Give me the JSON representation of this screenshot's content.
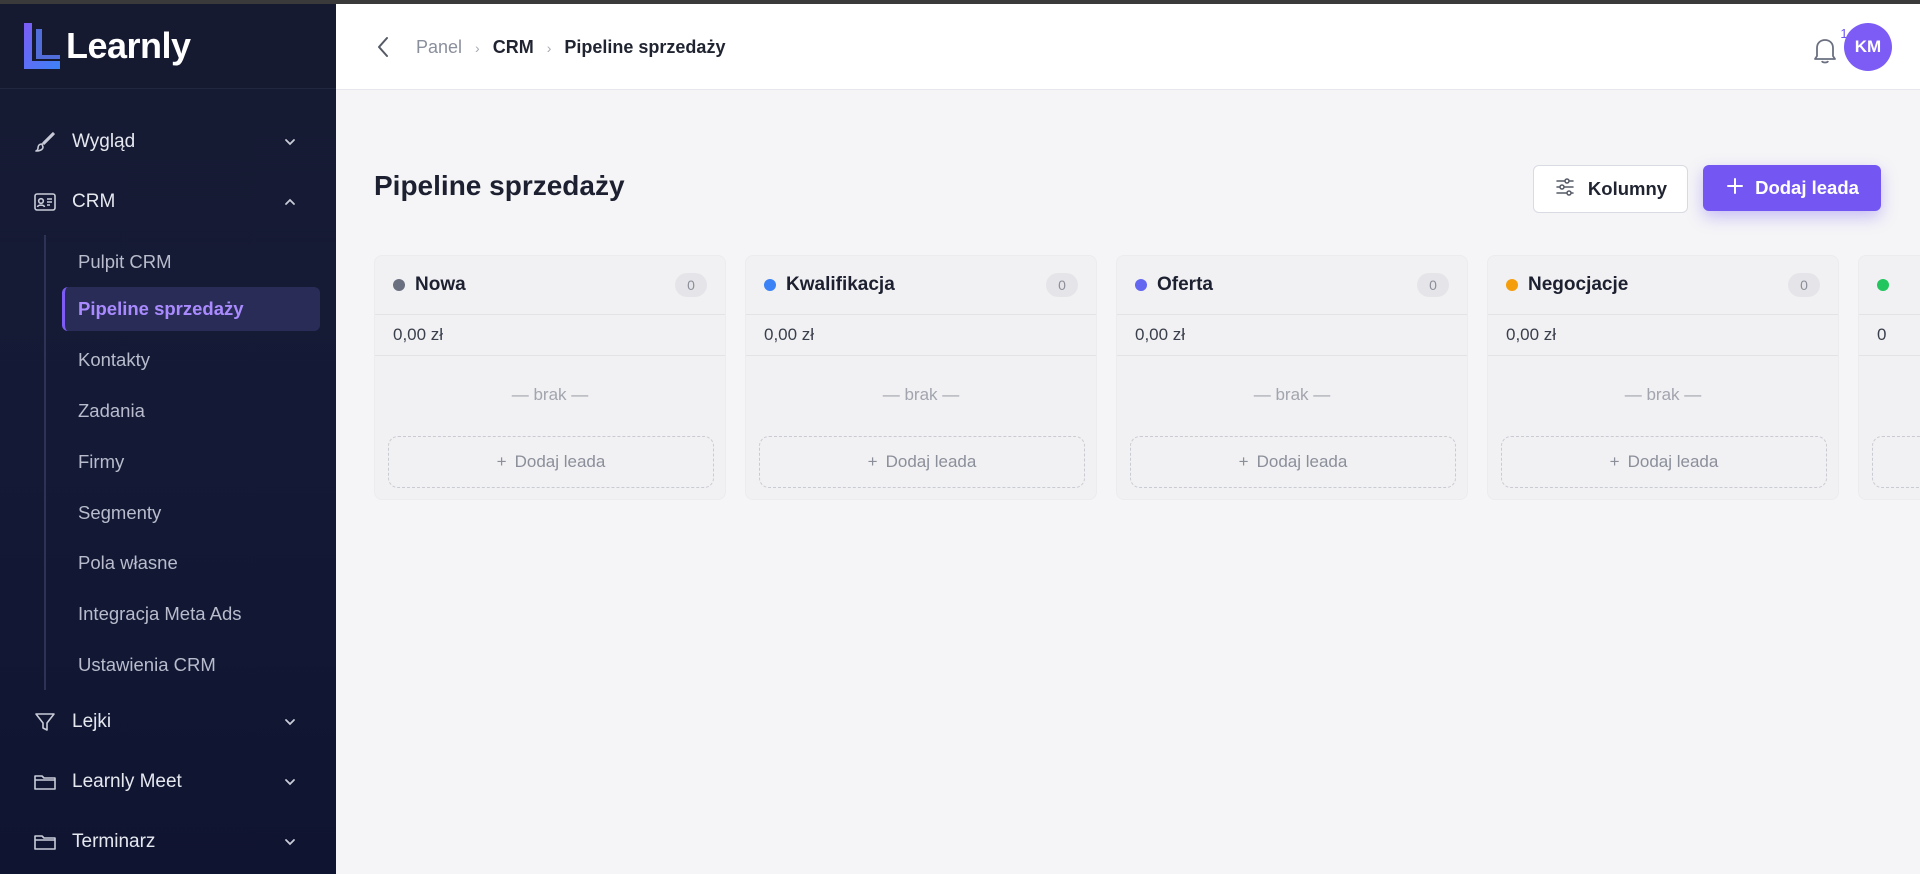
{
  "brand": {
    "name": "Learnly"
  },
  "sidebar": {
    "partial_label": "…",
    "items": [
      {
        "key": "wyglad",
        "label": "Wygląd",
        "icon": "brush-icon",
        "expanded": false
      },
      {
        "key": "crm",
        "label": "CRM",
        "icon": "id-card-icon",
        "expanded": true
      },
      {
        "key": "lejki",
        "label": "Lejki",
        "icon": "filter-icon",
        "expanded": false
      },
      {
        "key": "meet",
        "label": "Learnly Meet",
        "icon": "folder-icon",
        "expanded": false
      },
      {
        "key": "terminarz",
        "label": "Terminarz",
        "icon": "folder-icon",
        "expanded": false
      }
    ],
    "crm_subitems": [
      {
        "label": "Pulpit CRM",
        "active": false
      },
      {
        "label": "Pipeline sprzedaży",
        "active": true
      },
      {
        "label": "Kontakty",
        "active": false
      },
      {
        "label": "Zadania",
        "active": false
      },
      {
        "label": "Firmy",
        "active": false
      },
      {
        "label": "Segmenty",
        "active": false
      },
      {
        "label": "Pola własne",
        "active": false
      },
      {
        "label": "Integracja Meta Ads",
        "active": false
      },
      {
        "label": "Ustawienia CRM",
        "active": false
      }
    ]
  },
  "topbar": {
    "breadcrumbs": [
      "Panel",
      "CRM",
      "Pipeline sprzedaży"
    ],
    "notifications_count": "1",
    "avatar_initials": "KM"
  },
  "page": {
    "title": "Pipeline sprzedaży",
    "columns_button": "Kolumny",
    "add_lead_button": "Dodaj leada"
  },
  "board": {
    "columns": [
      {
        "title": "Nowa",
        "color": "#6b7080",
        "count": "0",
        "sum": "0,00 zł",
        "empty": "— brak —",
        "add": "Dodaj leada"
      },
      {
        "title": "Kwalifikacja",
        "color": "#3b82f6",
        "count": "0",
        "sum": "0,00 zł",
        "empty": "— brak —",
        "add": "Dodaj leada"
      },
      {
        "title": "Oferta",
        "color": "#6366f1",
        "count": "0",
        "sum": "0,00 zł",
        "empty": "— brak —",
        "add": "Dodaj leada"
      },
      {
        "title": "Negocjacje",
        "color": "#f59e0b",
        "count": "0",
        "sum": "0,00 zł",
        "empty": "— brak —",
        "add": "Dodaj leada"
      },
      {
        "title": "",
        "color": "#22c55e",
        "count": "",
        "sum": "0",
        "empty": "",
        "add": ""
      }
    ]
  }
}
